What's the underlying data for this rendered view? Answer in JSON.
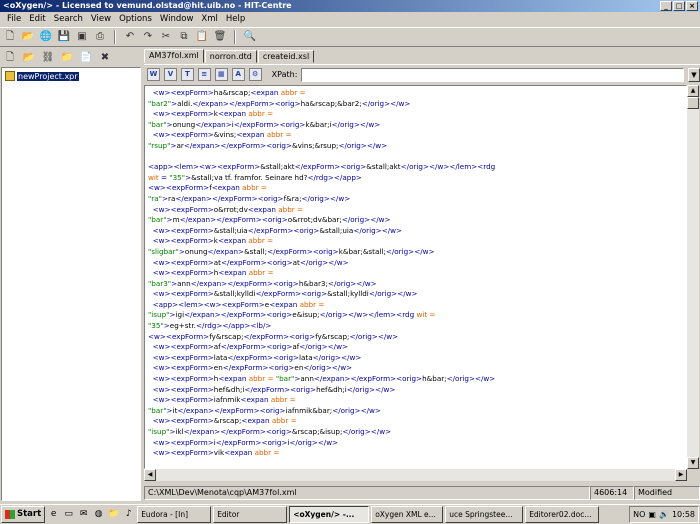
{
  "window": {
    "title": "<oXygen/> - Licensed to vemund.olstad@hit.uib.no - HIT-Centre"
  },
  "menu": [
    "File",
    "Edit",
    "Search",
    "View",
    "Options",
    "Window",
    "Xml",
    "Help"
  ],
  "project": {
    "file": "newProject.xpr"
  },
  "tabs": [
    {
      "label": "AM37fol.xml",
      "active": true
    },
    {
      "label": "norron.dtd",
      "active": false
    },
    {
      "label": "createid.xsl",
      "active": false
    }
  ],
  "xpath": {
    "label": "XPath:",
    "value": ""
  },
  "editor_lines": [
    [
      [
        "t",
        "  <w><expForm>"
      ],
      [
        "x",
        "ha&rscap;"
      ],
      [
        "t",
        "<expan "
      ],
      [
        "a",
        "abbr ="
      ]
    ],
    [
      [
        "v",
        "\"bar2\""
      ],
      [
        "t",
        ">"
      ],
      [
        "x",
        "aldi."
      ],
      [
        "t",
        "</expan></expForm><orig>"
      ],
      [
        "x",
        "ha&rscap;&bar2;"
      ],
      [
        "t",
        "</orig></w>"
      ]
    ],
    [
      [
        "t",
        "  <w><expForm>"
      ],
      [
        "x",
        "k"
      ],
      [
        "t",
        "<expan "
      ],
      [
        "a",
        "abbr ="
      ]
    ],
    [
      [
        "v",
        "\"bar\""
      ],
      [
        "t",
        ">"
      ],
      [
        "x",
        "onung"
      ],
      [
        "t",
        "</expan>"
      ],
      [
        "x",
        "i"
      ],
      [
        "t",
        "</expForm><orig>"
      ],
      [
        "x",
        "k&bar;i"
      ],
      [
        "t",
        "</orig></w>"
      ]
    ],
    [
      [
        "t",
        "  <w><expForm>"
      ],
      [
        "x",
        "&vins;"
      ],
      [
        "t",
        "<expan "
      ],
      [
        "a",
        "abbr ="
      ]
    ],
    [
      [
        "v",
        "\"rsup\""
      ],
      [
        "t",
        ">"
      ],
      [
        "x",
        "ar"
      ],
      [
        "t",
        "</expan></expForm><orig>"
      ],
      [
        "x",
        "&vins;&rsup;"
      ],
      [
        "t",
        "</orig></w>"
      ]
    ],
    [],
    [
      [
        "t",
        "<app><lem><w><expForm>"
      ],
      [
        "x",
        "&stall;akt"
      ],
      [
        "t",
        "</expForm><orig>"
      ],
      [
        "x",
        "&stall;akt"
      ],
      [
        "t",
        "</orig></w></lem><rdg"
      ]
    ],
    [
      [
        "a",
        "wit"
      ],
      [
        "t",
        " = "
      ],
      [
        "v",
        "\"35\""
      ],
      [
        "t",
        ">"
      ],
      [
        "x",
        "&stall;va tf. framfor. Seinare hd?"
      ],
      [
        "t",
        "</rdg></app>"
      ]
    ],
    [
      [
        "t",
        "<w><expForm>"
      ],
      [
        "x",
        "f"
      ],
      [
        "t",
        "<expan "
      ],
      [
        "a",
        "abbr ="
      ]
    ],
    [
      [
        "v",
        "\"ra\""
      ],
      [
        "t",
        ">"
      ],
      [
        "x",
        "ra"
      ],
      [
        "t",
        "</expan></expForm><orig>"
      ],
      [
        "x",
        "f&ra;"
      ],
      [
        "t",
        "</orig></w>"
      ]
    ],
    [
      [
        "t",
        "  <w><expForm>"
      ],
      [
        "x",
        "o&rrot;dv"
      ],
      [
        "t",
        "<expan "
      ],
      [
        "a",
        "abbr ="
      ]
    ],
    [
      [
        "v",
        "\"bar\""
      ],
      [
        "t",
        ">"
      ],
      [
        "x",
        "m"
      ],
      [
        "t",
        "</expan></expForm><orig>"
      ],
      [
        "x",
        "o&rrot;dv&bar;"
      ],
      [
        "t",
        "</orig></w>"
      ]
    ],
    [
      [
        "t",
        "  <w><expForm>"
      ],
      [
        "x",
        "&stall;uia"
      ],
      [
        "t",
        "</expForm><orig>"
      ],
      [
        "x",
        "&stall;uia"
      ],
      [
        "t",
        "</orig></w>"
      ]
    ],
    [
      [
        "t",
        "  <w><expForm>"
      ],
      [
        "x",
        "k"
      ],
      [
        "t",
        "<expan "
      ],
      [
        "a",
        "abbr ="
      ]
    ],
    [
      [
        "v",
        "\"sligbar\""
      ],
      [
        "t",
        ">"
      ],
      [
        "x",
        "onung"
      ],
      [
        "t",
        "</expan>"
      ],
      [
        "x",
        "&stall;"
      ],
      [
        "t",
        "</expForm><orig>"
      ],
      [
        "x",
        "k&bar;&stall;"
      ],
      [
        "t",
        "</orig></w>"
      ]
    ],
    [
      [
        "t",
        "  <w><expForm>"
      ],
      [
        "x",
        "at"
      ],
      [
        "t",
        "</expForm><orig>"
      ],
      [
        "x",
        "at"
      ],
      [
        "t",
        "</orig></w>"
      ]
    ],
    [
      [
        "t",
        "  <w><expForm>"
      ],
      [
        "x",
        "h"
      ],
      [
        "t",
        "<expan "
      ],
      [
        "a",
        "abbr ="
      ]
    ],
    [
      [
        "v",
        "\"bar3\""
      ],
      [
        "t",
        ">"
      ],
      [
        "x",
        "ann"
      ],
      [
        "t",
        "</expan></expForm><orig>"
      ],
      [
        "x",
        "h&bar3;"
      ],
      [
        "t",
        "</orig></w>"
      ]
    ],
    [
      [
        "t",
        "  <w><expForm>"
      ],
      [
        "x",
        "&stall;kylldi"
      ],
      [
        "t",
        "</expForm><orig>"
      ],
      [
        "x",
        "&stall;kylldi"
      ],
      [
        "t",
        "</orig></w>"
      ]
    ],
    [
      [
        "t",
        "  <app><lem><w><expForm>"
      ],
      [
        "x",
        "e"
      ],
      [
        "t",
        "<expan "
      ],
      [
        "a",
        "abbr ="
      ]
    ],
    [
      [
        "v",
        "\"isup\""
      ],
      [
        "t",
        ">"
      ],
      [
        "x",
        "igi"
      ],
      [
        "t",
        "</expan></expForm><orig>"
      ],
      [
        "x",
        "e&isup;"
      ],
      [
        "t",
        "</orig></w></lem><rdg "
      ],
      [
        "a",
        "wit ="
      ]
    ],
    [
      [
        "v",
        "\"35\""
      ],
      [
        "t",
        ">"
      ],
      [
        "x",
        "eg+str."
      ],
      [
        "t",
        "</rdg></app><lb/>"
      ]
    ],
    [
      [
        "t",
        "<w><expForm>"
      ],
      [
        "x",
        "fy&rscap;"
      ],
      [
        "t",
        "</expForm><orig>"
      ],
      [
        "x",
        "fy&rscap;"
      ],
      [
        "t",
        "</orig></w>"
      ]
    ],
    [
      [
        "t",
        "  <w><expForm>"
      ],
      [
        "x",
        "af"
      ],
      [
        "t",
        "</expForm><orig>"
      ],
      [
        "x",
        "af"
      ],
      [
        "t",
        "</orig></w>"
      ]
    ],
    [
      [
        "t",
        "  <w><expForm>"
      ],
      [
        "x",
        "lata"
      ],
      [
        "t",
        "</expForm><orig>"
      ],
      [
        "x",
        "lata"
      ],
      [
        "t",
        "</orig></w>"
      ]
    ],
    [
      [
        "t",
        "  <w><expForm>"
      ],
      [
        "x",
        "en"
      ],
      [
        "t",
        "</expForm><orig>"
      ],
      [
        "x",
        "en"
      ],
      [
        "t",
        "</orig></w>"
      ]
    ],
    [
      [
        "t",
        "  <w><expForm>"
      ],
      [
        "x",
        "h"
      ],
      [
        "t",
        "<expan "
      ],
      [
        "a",
        "abbr ="
      ],
      [
        "t",
        " "
      ],
      [
        "v",
        "\"bar\""
      ],
      [
        "t",
        ">"
      ],
      [
        "x",
        "ann"
      ],
      [
        "t",
        "</expan></expForm><orig>"
      ],
      [
        "x",
        "h&bar;"
      ],
      [
        "t",
        "</orig></w>"
      ]
    ],
    [
      [
        "t",
        "  <w><expForm>"
      ],
      [
        "x",
        "hef&dh;i"
      ],
      [
        "t",
        "</expForm><orig>"
      ],
      [
        "x",
        "hef&dh;i"
      ],
      [
        "t",
        "</orig></w>"
      ]
    ],
    [
      [
        "t",
        "  <w><expForm>"
      ],
      [
        "x",
        "iafnmik"
      ],
      [
        "t",
        "<expan "
      ],
      [
        "a",
        "abbr ="
      ]
    ],
    [
      [
        "v",
        "\"bar\""
      ],
      [
        "t",
        ">"
      ],
      [
        "x",
        "it"
      ],
      [
        "t",
        "</expan></expForm><orig>"
      ],
      [
        "x",
        "iafnmik&bar;"
      ],
      [
        "t",
        "</orig></w>"
      ]
    ],
    [
      [
        "t",
        "  <w><expForm>"
      ],
      [
        "x",
        "&rscap;"
      ],
      [
        "t",
        "<expan "
      ],
      [
        "a",
        "abbr ="
      ]
    ],
    [
      [
        "v",
        "\"isup\""
      ],
      [
        "t",
        ">"
      ],
      [
        "x",
        "ikl"
      ],
      [
        "t",
        "</expan></expForm><orig>"
      ],
      [
        "x",
        "&rscap;&isup;"
      ],
      [
        "t",
        "</orig></w>"
      ]
    ],
    [
      [
        "t",
        "  <w><expForm>"
      ],
      [
        "x",
        "i"
      ],
      [
        "t",
        "</expForm><orig>"
      ],
      [
        "x",
        "i"
      ],
      [
        "t",
        "</orig></w>"
      ]
    ],
    [
      [
        "t",
        "  <w><expForm>"
      ],
      [
        "x",
        "vik"
      ],
      [
        "t",
        "<expan "
      ],
      [
        "a",
        "abbr ="
      ]
    ]
  ],
  "status": {
    "path": "C:\\XML\\Dev\\Menota\\cqp\\AM37fol.xml",
    "position": "4606:14",
    "state": "Modified"
  },
  "taskbar": {
    "start": "Start",
    "tasks": [
      {
        "label": "Eudora - [In]",
        "active": false
      },
      {
        "label": "Editor",
        "active": false
      },
      {
        "label": "<oXygen/> -...",
        "active": true
      },
      {
        "label": "oXygen XML e...",
        "active": false
      },
      {
        "label": "uce Springstee...",
        "active": false
      },
      {
        "label": "Editorer02.doc...",
        "active": false
      }
    ],
    "lang": "NO",
    "time": "10:58"
  },
  "colors": {
    "title_start": "#0a246a",
    "title_end": "#a6caf0",
    "tag": "#0000a0",
    "attr": "#e06000",
    "value": "#008000"
  }
}
